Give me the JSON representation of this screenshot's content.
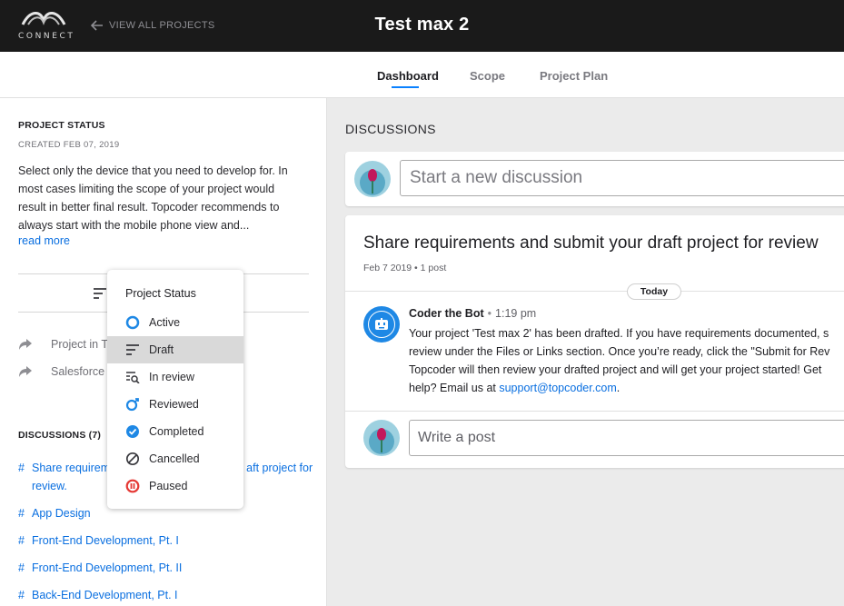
{
  "header": {
    "logo_text": "CONNECT",
    "back_label": "VIEW ALL PROJECTS",
    "project_title": "Test max 2"
  },
  "tabs": [
    {
      "label": "Dashboard",
      "active": true
    },
    {
      "label": "Scope",
      "active": false
    },
    {
      "label": "Project Plan",
      "active": false
    }
  ],
  "sidebar": {
    "status_heading": "PROJECT STATUS",
    "created": "CREATED FEB 07, 2019",
    "description_lines": [
      "Select only the device that you need to develop for. In",
      "most cases limiting the scope of your project would",
      "result in better final result. Topcoder recommends to",
      "always start with the mobile phone view and..."
    ],
    "read_more": "read more",
    "links": [
      {
        "label": "Project in T",
        "icon": "share-arrow-icon"
      },
      {
        "label": "Salesforce",
        "icon": "share-arrow-icon"
      }
    ],
    "discussions_heading": "DISCUSSIONS (7)",
    "discussions": [
      {
        "hash": "#",
        "line1": "Share requirem",
        "line1b": "aft project for",
        "line2": "review."
      },
      {
        "hash": "#",
        "label": "App Design"
      },
      {
        "hash": "#",
        "label": "Front-End Development, Pt. I"
      },
      {
        "hash": "#",
        "label": "Front-End Development, Pt. II"
      },
      {
        "hash": "#",
        "label": "Back-End Development, Pt. I"
      }
    ]
  },
  "status_menu": {
    "title": "Project Status",
    "selected": "Draft",
    "items": [
      {
        "label": "Active",
        "icon": "active-circle-icon",
        "color": "#1e88e5"
      },
      {
        "label": "Draft",
        "icon": "draft-lines-icon",
        "color": "#37373c"
      },
      {
        "label": "In review",
        "icon": "in-review-icon",
        "color": "#37373c"
      },
      {
        "label": "Reviewed",
        "icon": "reviewed-icon",
        "color": "#1e88e5"
      },
      {
        "label": "Completed",
        "icon": "check-circle-icon",
        "color": "#1e88e5"
      },
      {
        "label": "Cancelled",
        "icon": "cancelled-icon",
        "color": "#37373c"
      },
      {
        "label": "Paused",
        "icon": "paused-icon",
        "color": "#e53935"
      }
    ]
  },
  "main": {
    "discussions_heading": "DISCUSSIONS",
    "new_discussion_placeholder": "Start a new discussion",
    "thread": {
      "title": "Share requirements and submit your draft project for review",
      "meta": "Feb 7 2019  •  1 post",
      "day_label": "Today",
      "post": {
        "author": "Coder the Bot",
        "dot": "•",
        "time": "1:19 pm",
        "lines": [
          "Your project 'Test max 2' has been drafted. If you have requirements documented, s",
          "review under the Files or Links section. Once you’re ready, click the \"Submit for Rev",
          "Topcoder will then review your drafted project and will get your project started! Get",
          "help? Email us at "
        ],
        "email": "support@topcoder.com",
        "email_suffix": "."
      },
      "write_placeholder": "Write a post"
    }
  }
}
